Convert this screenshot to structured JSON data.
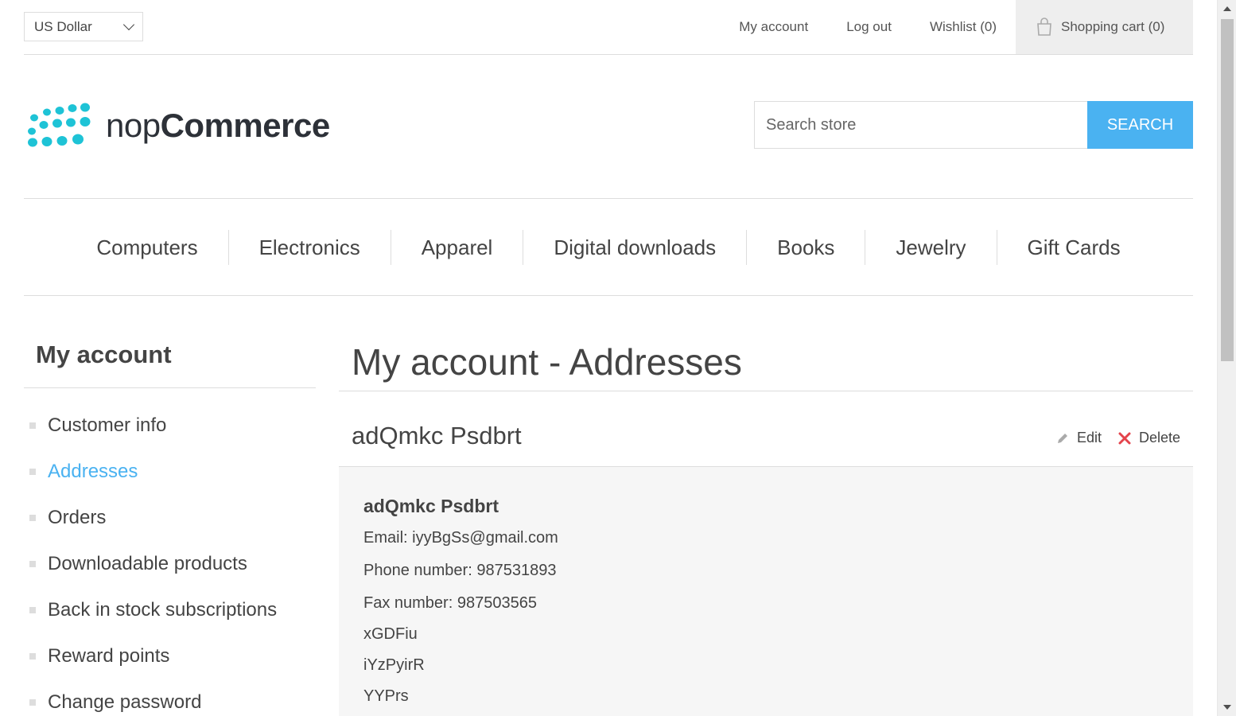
{
  "header": {
    "currency": "US Dollar",
    "links": {
      "my_account": "My account",
      "log_out": "Log out",
      "wishlist": "Wishlist (0)",
      "cart": "Shopping cart (0)"
    }
  },
  "logo": {
    "light": "nop",
    "bold": "Commerce",
    "brand_color": "#1ec3d6"
  },
  "search": {
    "placeholder": "Search store",
    "button": "SEARCH"
  },
  "menu": [
    "Computers",
    "Electronics",
    "Apparel",
    "Digital downloads",
    "Books",
    "Jewelry",
    "Gift Cards"
  ],
  "sidebar": {
    "title": "My account",
    "items": [
      {
        "label": "Customer info"
      },
      {
        "label": "Addresses",
        "active": true
      },
      {
        "label": "Orders"
      },
      {
        "label": "Downloadable products"
      },
      {
        "label": "Back in stock subscriptions"
      },
      {
        "label": "Reward points"
      },
      {
        "label": "Change password"
      }
    ]
  },
  "main": {
    "title": "My account - Addresses",
    "address": {
      "title": "adQmkc Psdbrt",
      "edit": "Edit",
      "delete": "Delete",
      "name": "adQmkc Psdbrt",
      "email_label": "Email:",
      "email": "iyyBgSs@gmail.com",
      "phone_label": "Phone number:",
      "phone": "987531893",
      "fax_label": "Fax number:",
      "fax": "987503565",
      "line1": "xGDFiu",
      "line2": "iYzPyirR",
      "line3": "YYPrs"
    }
  },
  "colors": {
    "accent": "#4ab2f1",
    "delete": "#e4434b"
  }
}
